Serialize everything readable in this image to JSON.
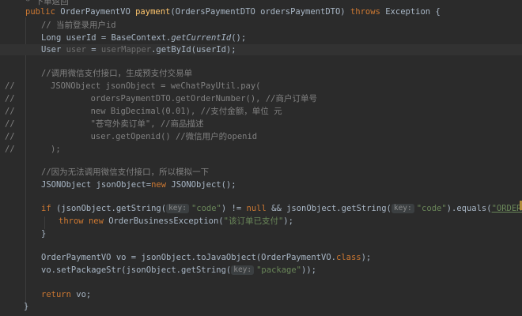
{
  "code": {
    "top_partial": "* 下单返回",
    "sig": {
      "mod": "public",
      "ret": "OrderPaymentVO",
      "name": "payment",
      "params": "(OrdersPaymentDTO ordersPaymentDTO)",
      "throws_kw": "throws",
      "exc": "Exception",
      "brace": "{"
    },
    "c_user": "// 当前登录用户id",
    "l_userid": {
      "pre": "Long userId = BaseContext.",
      "call": "getCurrentId",
      "post": "();"
    },
    "l_user": {
      "type": "User ",
      "var": "user",
      "mid": " = ",
      "mapper": "userMapper",
      "post": ".getById(userId);"
    },
    "c_wx": "//调用微信支付接口，生成预支付交易单",
    "commented": [
      "JSONObject jsonObject = weChatPayUtil.pay(",
      "        ordersPaymentDTO.getOrderNumber(), //商户订单号",
      "        new BigDecimal(0.01), //支付金额，单位 元",
      "        \"苍穹外卖订单\", //商品描述",
      "        user.getOpenid() //微信用户的openid",
      ");"
    ],
    "c_mock": "//因为无法调用微信支付接口，所以模拟一下",
    "l_json": {
      "pre": "JSONObject jsonObject=",
      "new_kw": "new",
      "post": " JSONObject();"
    },
    "l_if": {
      "if_kw": "if",
      "a": " (jsonObject.getString(",
      "hint": "key:",
      "s1": "\"code\"",
      "b": ") != ",
      "null_kw": "null",
      "c": " && jsonObject.getString(",
      "s2": "\"code\"",
      "d": ").equals(",
      "s3": "\"ORDERPAID\"",
      "e": ")) {"
    },
    "l_throw": {
      "throw_kw": "throw",
      "new_kw": "new",
      "post": " OrderBusinessException(",
      "str": "\"该订单已支付\"",
      "end": ");"
    },
    "close": "}",
    "l_vo": {
      "pre": "OrderPaymentVO vo = jsonObject.toJavaObject(OrderPaymentVO.",
      "cls": "class",
      "post": ");"
    },
    "l_pkg": {
      "pre": "vo.setPackageStr(jsonObject.getString(",
      "hint": "key:",
      "str": "\"package\"",
      "post": "));"
    },
    "l_ret": {
      "kw": "return",
      "post": " vo;"
    },
    "line_comment_mark": "//"
  },
  "colors": {
    "background": "#2b2b2b",
    "keyword": "#cc7832",
    "method_decl": "#ffc66d",
    "comment": "#808080",
    "string": "#6a8759",
    "text": "#a9b7c6"
  }
}
